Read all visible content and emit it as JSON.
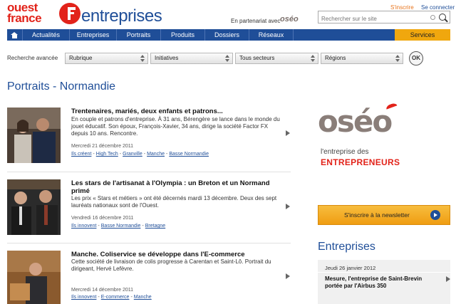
{
  "header": {
    "logo_text_line1": "ouest",
    "logo_text_line2": "france",
    "brand": "entreprises",
    "partner_label": "En partenariat avec",
    "partner_logo": "oséo",
    "link_inscrire": "S'inscrire",
    "link_connecter": "Se connecter",
    "search_placeholder": "Rechercher sur le site"
  },
  "nav": {
    "items": [
      "Actualités",
      "Entreprises",
      "Portraits",
      "Produits",
      "Dossiers",
      "Réseaux"
    ],
    "services": "Services"
  },
  "filters": {
    "label": "Recherche avancée",
    "selects": [
      "Rubrique",
      "Initiatives",
      "Tous secteurs",
      "Régions"
    ],
    "ok": "OK"
  },
  "page_title": "Portraits - Normandie",
  "articles": [
    {
      "title": "Trentenaires, mariés, deux enfants et patrons...",
      "desc": "En couple et patrons d'entreprise. À 31 ans, Bérengère se lance dans le monde du jouet éducatif. Son époux, François-Xavier, 34 ans, dirige la société Factor FX depuis 10 ans. Rencontre.",
      "date": "Mercredi 21 décembre 2011",
      "tags": [
        "Ils créent",
        "High Tech",
        "Granville",
        "Manche",
        "Basse Normandie"
      ]
    },
    {
      "title": "Les stars de l'artisanat à l'Olympia : un Breton et un Normand primé",
      "desc": "Les prix « Stars et métiers » ont été décernés mardi 13 décembre. Deux des sept lauréats nationaux sont de l'Ouest.",
      "date": "Vendredi 16 décembre 2011",
      "tags": [
        "Ils innovent",
        "Basse Normandie",
        "Bretagne"
      ]
    },
    {
      "title": "Manche. Coliservice se développe dans l'E-commerce",
      "desc": "Cette société de livraison de colis progresse à Carentan et Saint-Lô. Portrait du dirigeant, Hervé Lefèvre.",
      "date": "Mercredi 14 décembre 2011",
      "tags": [
        "Ils innovent",
        "E-commerce",
        "Manche"
      ]
    }
  ],
  "sidebar": {
    "oseo_word": "oséo",
    "oseo_tag_line1": "l'entreprise des",
    "oseo_tag_line2": "ENTREPRENEURS",
    "newsletter": "S'inscrire à la newsletter",
    "ent_title": "Entreprises",
    "ent_date": "Jeudi 26 janvier 2012",
    "ent_headline": "Mesure, l'entreprise de Saint-Brevin portée par l'Airbus 350"
  },
  "colors": {
    "brand_blue": "#1f4e98",
    "brand_red": "#e2231a",
    "accent_orange": "#f0a70e"
  }
}
